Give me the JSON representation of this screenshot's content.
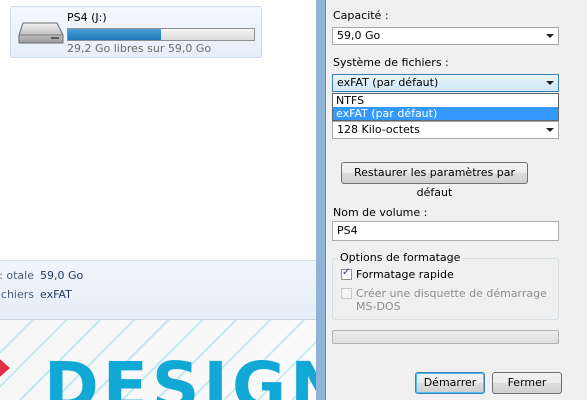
{
  "explorer": {
    "drive": {
      "name": "PS4 (J:)",
      "free_text": "29,2 Go libres sur 59,0 Go",
      "used_fraction": 0.5
    },
    "details": {
      "total_label": "otale :",
      "total_value": "59,0 Go",
      "fs_label": "chiers :",
      "fs_value": "exFAT"
    },
    "background_text": "DESIGN"
  },
  "dialog": {
    "capacity_label": "Capacité :",
    "capacity_value": "59,0 Go",
    "filesystem_label": "Système de fichiers :",
    "filesystem_value": "exFAT (par défaut)",
    "filesystem_options": [
      "NTFS",
      "exFAT (par défaut)"
    ],
    "filesystem_selected_index": 1,
    "alloc_value": "128 Kilo-octets",
    "restore_button": "Restaurer les paramètres par défaut",
    "volume_label": "Nom de volume :",
    "volume_value": "PS4",
    "format_options_title": "Options de formatage",
    "quick_format_label": "Formatage rapide",
    "quick_format_checked": true,
    "boot_disk_label_line1": "Créer une disquette de démarrage",
    "boot_disk_label_line2": "MS-DOS",
    "boot_disk_checked": false,
    "progress": 0,
    "start_button": "Démarrer",
    "close_button": "Fermer"
  },
  "colors": {
    "accent": "#3399ff",
    "frame": "#8fb3d6",
    "drive_bar": "#1f78b8",
    "design_text": "#12a8d6"
  }
}
